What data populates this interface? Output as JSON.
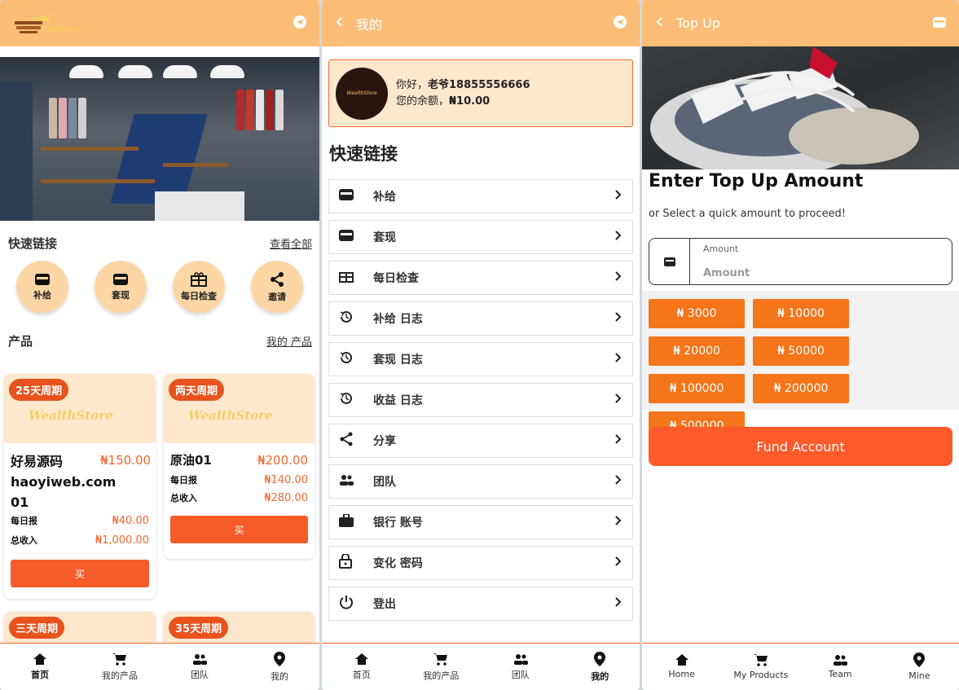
{
  "home": {
    "logo_text": "WealthStore",
    "quick_links_title": "快速链接",
    "view_all": "查看全部",
    "quick": [
      {
        "label": "补给",
        "icon": "wallet-icon"
      },
      {
        "label": "套现",
        "icon": "wallet-icon"
      },
      {
        "label": "每日检查",
        "icon": "gift-icon"
      },
      {
        "label": "邀请",
        "icon": "share-icon"
      }
    ],
    "products_title": "产品",
    "my_products": "我的 产品",
    "cards": [
      {
        "badge": "25天周期",
        "brand": "WealthStore",
        "name": "好易源码 haoyiweb.com 01",
        "price": "₦150.00",
        "daily_label": "每日报",
        "daily": "₦40.00",
        "total_label": "总收入",
        "total": "₦1,000.00",
        "buy": "买"
      },
      {
        "badge": "两天周期",
        "brand": "WealthStore",
        "name": "原油01",
        "price": "₦200.00",
        "daily_label": "每日报",
        "daily": "₦140.00",
        "total_label": "总收入",
        "total": "₦280.00",
        "buy": "买"
      },
      {
        "badge": "三天周期"
      },
      {
        "badge": "35天周期"
      }
    ],
    "tabs": [
      "首页",
      "我的产品",
      "团队",
      "我的"
    ]
  },
  "mine": {
    "title": "我的",
    "greeting_prefix": "你好，",
    "username": "老爷18855556666",
    "balance_prefix": "您的余额，",
    "balance": "₦10.00",
    "avatar_text": "WealthStore",
    "quick_links_title": "快速链接",
    "menu": [
      {
        "label": "补给",
        "icon": "wallet-icon"
      },
      {
        "label": "套现",
        "icon": "wallet-icon"
      },
      {
        "label": "每日检查",
        "icon": "gift-icon"
      },
      {
        "label": "补给 日志",
        "icon": "history-icon"
      },
      {
        "label": "套现 日志",
        "icon": "history-icon"
      },
      {
        "label": "收益 日志",
        "icon": "history-icon"
      },
      {
        "label": "分享",
        "icon": "share-icon"
      },
      {
        "label": "团队",
        "icon": "team-icon"
      },
      {
        "label": "银行 账号",
        "icon": "briefcase-icon"
      },
      {
        "label": "变化 密码",
        "icon": "lock-icon"
      },
      {
        "label": "登出",
        "icon": "power-icon"
      }
    ],
    "tabs": [
      "首页",
      "我的产品",
      "团队",
      "我的"
    ]
  },
  "topup": {
    "title": "Top Up",
    "heading": "Enter Top Up Amount",
    "subtitle": "or Select a quick amount to proceed!",
    "amount_label": "Amount",
    "amount_placeholder": "Amount",
    "amounts": [
      "₦ 3000",
      "₦ 10000",
      "₦ 20000",
      "₦ 50000",
      "₦ 100000",
      "₦ 200000",
      "₦ 500000"
    ],
    "fund_button": "Fund Account",
    "tabs": [
      "Home",
      "My Products",
      "Team",
      "Mine"
    ]
  },
  "colors": {
    "header": "#fcbd77",
    "accent": "#f4672e",
    "chip": "#f4751a",
    "card_top": "#fde8cd"
  }
}
